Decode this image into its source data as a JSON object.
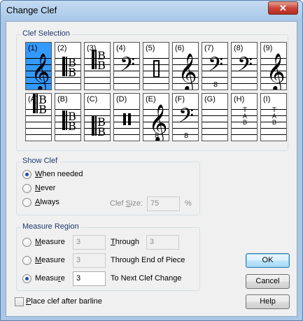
{
  "window": {
    "title": "Change Clef",
    "close_glyph": "✕"
  },
  "clef_selection": {
    "label": "Clef Selection",
    "row1": [
      {
        "label": "(1)",
        "icon": "treble-clef"
      },
      {
        "label": "(2)",
        "icon": "alto-clef"
      },
      {
        "label": "(3)",
        "icon": "tenor-clef"
      },
      {
        "label": "(4)",
        "icon": "bass-clef"
      },
      {
        "label": "(5)",
        "icon": "percussion-rect-clef"
      },
      {
        "label": "(6)",
        "icon": "treble-clef"
      },
      {
        "label": "(7)",
        "icon": "bass-8vb-clef",
        "sub": "8"
      },
      {
        "label": "(8)",
        "icon": "bass-clef-high"
      },
      {
        "label": "(9)",
        "icon": "treble-clef-high"
      }
    ],
    "row2": [
      {
        "label": "(A)",
        "icon": "c-clef-top"
      },
      {
        "label": "(B)",
        "icon": "c-clef"
      },
      {
        "label": "(C)",
        "icon": "c-clef-low"
      },
      {
        "label": "(D)",
        "icon": "percussion-bar-clef"
      },
      {
        "label": "(E)",
        "icon": "treble-8va-clef",
        "sub": "8"
      },
      {
        "label": "(F)",
        "icon": "bass-8va-clef",
        "sub": "8"
      },
      {
        "label": "(G)",
        "icon": "blank-clef"
      },
      {
        "label": "(H)",
        "icon": "tab-clef",
        "tab": [
          "T",
          "A",
          "B"
        ]
      },
      {
        "label": "(I)",
        "icon": "tab-clef-small",
        "tab": [
          "T",
          "A",
          "B"
        ]
      }
    ],
    "selected_index": 0
  },
  "show_clef": {
    "label": "Show Clef",
    "options": [
      {
        "prefix": "",
        "u": "W",
        "rest": "hen needed",
        "checked": true
      },
      {
        "prefix": "",
        "u": "N",
        "rest": "ever",
        "checked": false
      },
      {
        "prefix": "",
        "u": "A",
        "rest": "lways",
        "checked": false
      }
    ],
    "clef_size_label_pre": "Clef ",
    "clef_size_label_u": "S",
    "clef_size_label_post": "ize:",
    "clef_size_value": "75",
    "clef_size_unit": "%"
  },
  "measure_region": {
    "label": "Measure Region",
    "rows": [
      {
        "prefix": "",
        "u": "M",
        "rest": "easure",
        "value": "3",
        "checked": false,
        "enabled": false,
        "through_label": "Through",
        "through_u": "T",
        "through_rest": "hrough",
        "through_value": "3"
      },
      {
        "prefix": "",
        "u": "M",
        "rest": "easure",
        "value": "3",
        "checked": false,
        "enabled": false,
        "through_label": "Through End of Piece"
      },
      {
        "prefix": "Measu",
        "u": "r",
        "rest": "e",
        "value": "3",
        "checked": true,
        "enabled": true,
        "through_label": "To Next Clef Change"
      }
    ]
  },
  "buttons": {
    "ok": "OK",
    "cancel": "Cancel",
    "help": "Help"
  },
  "place_after_barline": {
    "u": "P",
    "rest": "lace clef after barline",
    "checked": false
  }
}
